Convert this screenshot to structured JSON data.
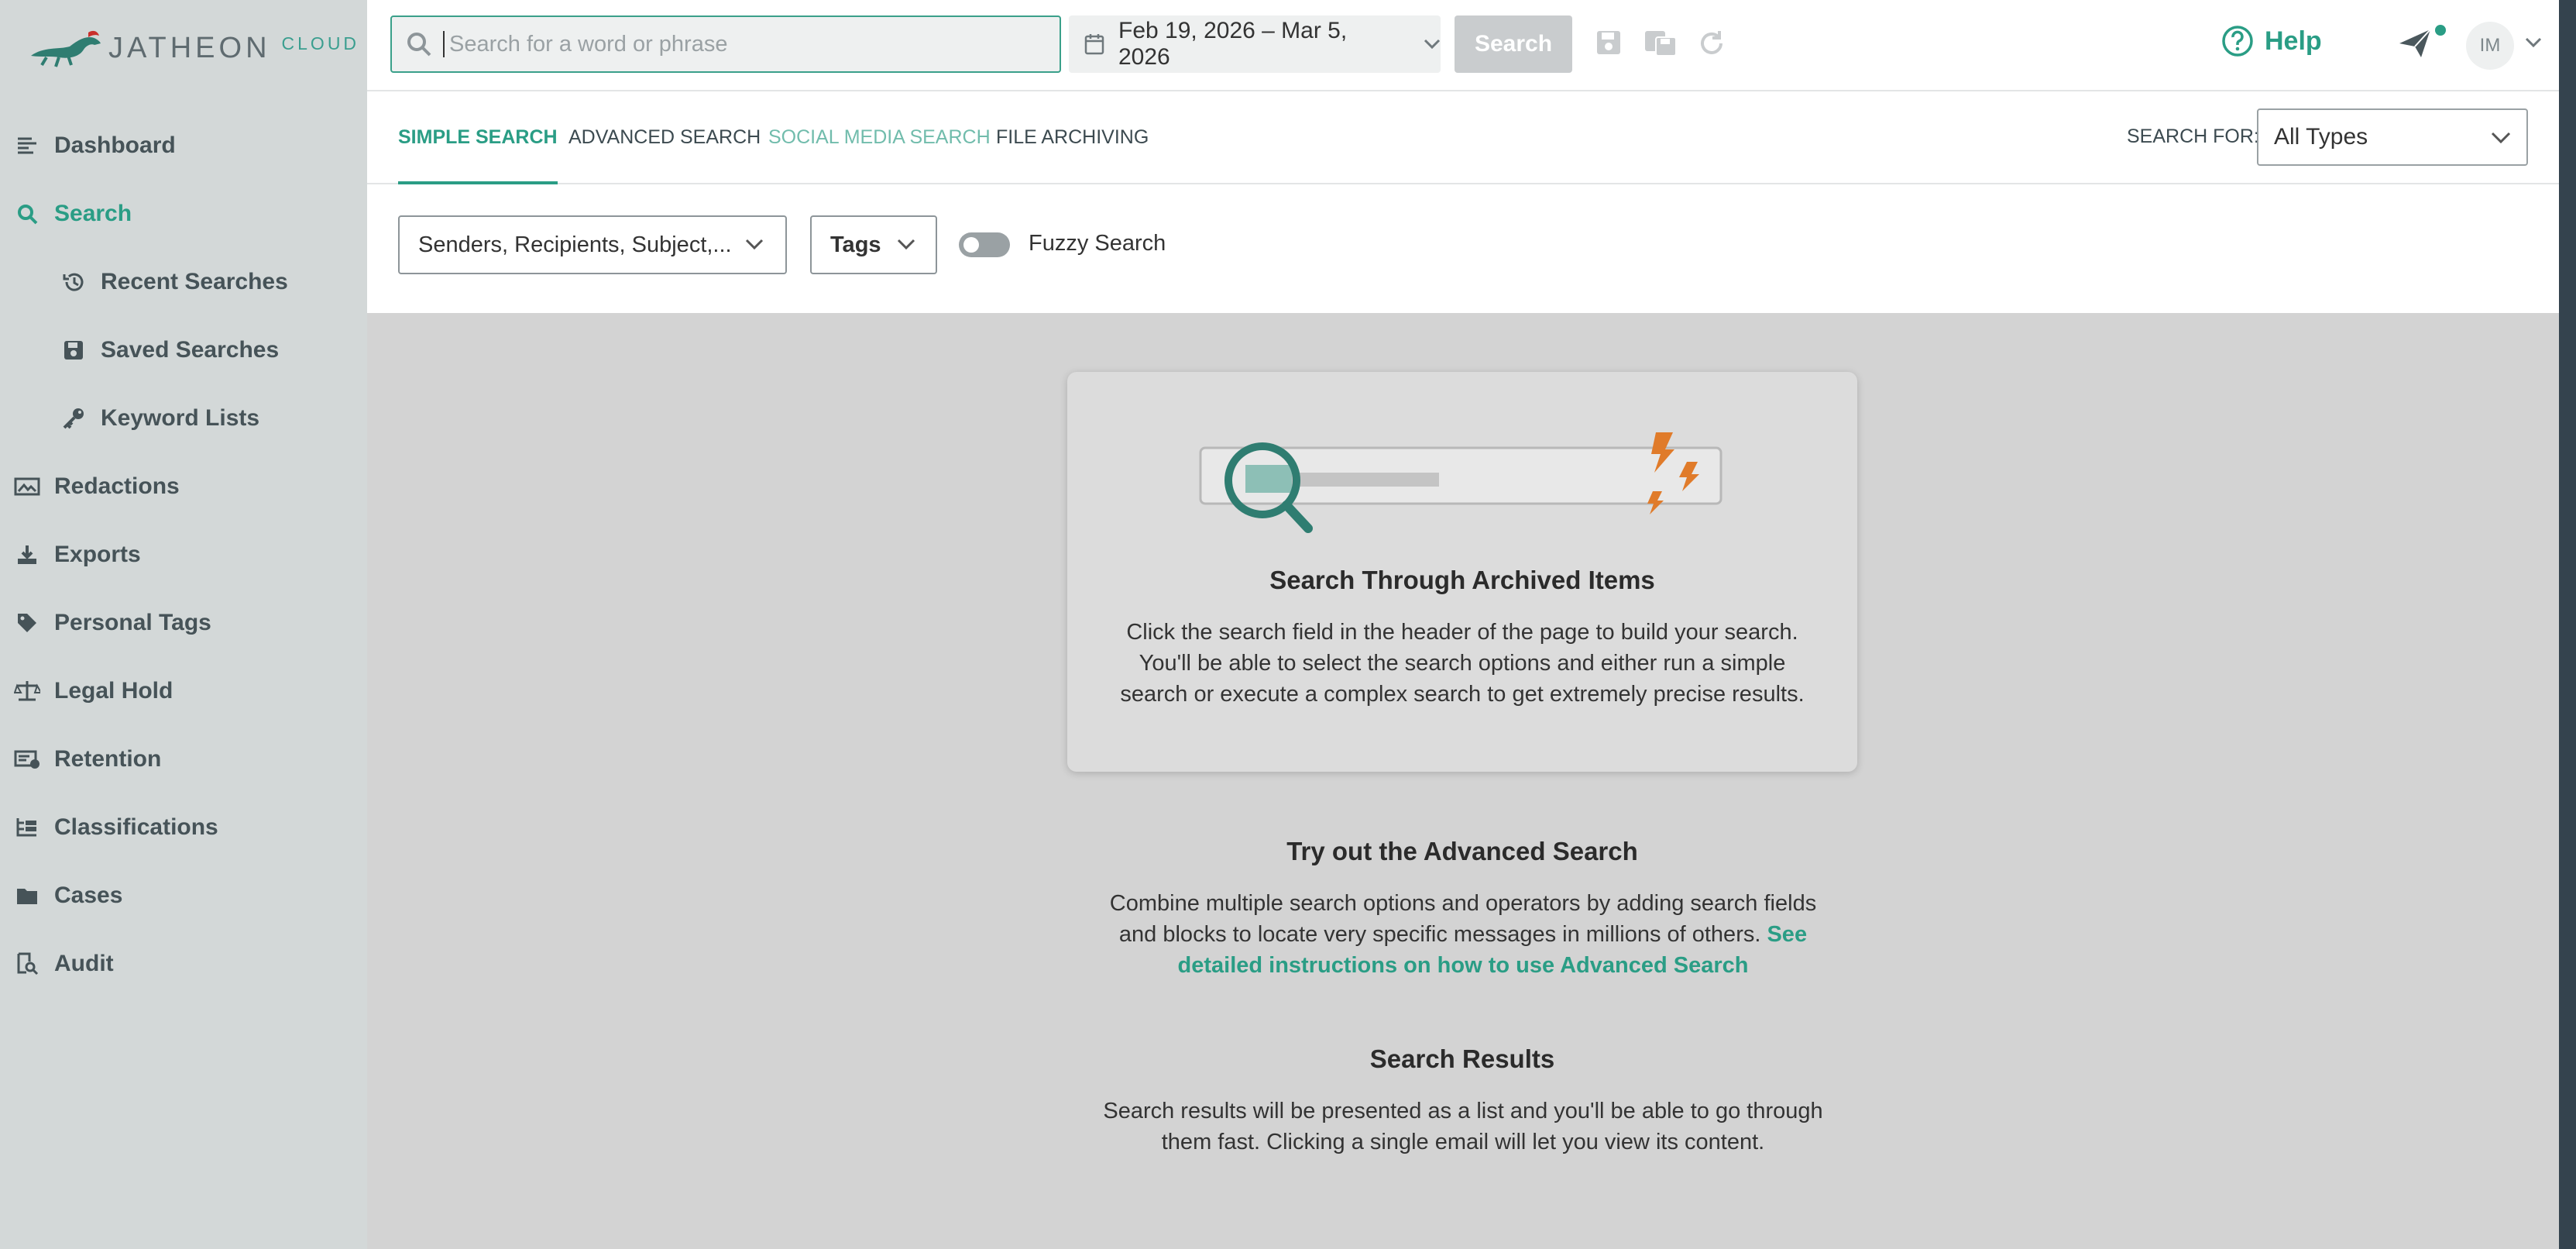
{
  "brand": {
    "name": "JATHEON",
    "suffix": "CLOUD"
  },
  "header": {
    "search_placeholder": "Search for a word or phrase",
    "date_range": "Feb 19, 2026 – Mar 5, 2026",
    "search_button": "Search",
    "help_label": "Help",
    "avatar_initials": "IM"
  },
  "sidebar": {
    "items": [
      {
        "label": "Dashboard",
        "icon": "dashboard-icon"
      },
      {
        "label": "Search",
        "icon": "search-icon",
        "active": true
      },
      {
        "label": "Recent Searches",
        "icon": "history-icon"
      },
      {
        "label": "Saved Searches",
        "icon": "floppy-disk-icon"
      },
      {
        "label": "Keyword Lists",
        "icon": "key-icon"
      },
      {
        "label": "Redactions",
        "icon": "redaction-icon"
      },
      {
        "label": "Exports",
        "icon": "download-icon"
      },
      {
        "label": "Personal Tags",
        "icon": "tag-icon"
      },
      {
        "label": "Legal Hold",
        "icon": "scales-icon"
      },
      {
        "label": "Retention",
        "icon": "retention-icon"
      },
      {
        "label": "Classifications",
        "icon": "classification-icon"
      },
      {
        "label": "Cases",
        "icon": "folder-icon"
      },
      {
        "label": "Audit",
        "icon": "audit-icon"
      }
    ]
  },
  "tabs": {
    "simple": "SIMPLE SEARCH",
    "advanced": "ADVANCED SEARCH",
    "social": "SOCIAL MEDIA SEARCH",
    "files": "FILE ARCHIVING",
    "search_for_label": "SEARCH FOR:",
    "search_for_value": "All Types"
  },
  "filters": {
    "fields_value": "Senders, Recipients, Subject,...",
    "tags_label": "Tags",
    "fuzzy_label": "Fuzzy Search",
    "fuzzy_enabled": false
  },
  "main": {
    "card_title": "Search Through Archived Items",
    "card_text": "Click the search field in the header of the page to build your search. You'll be able to select the search options and either run a simple search or execute a complex search to get extremely precise results.",
    "advanced_title": "Try out the Advanced Search",
    "advanced_text": "Combine multiple search options and operators by adding search fields and blocks to locate very specific messages in millions of others.",
    "advanced_link": "See detailed instructions on how to use Advanced Search",
    "results_title": "Search Results",
    "results_text": "Search results will be presented as a list and you'll be able to go through them fast. Clicking a single email will let you view its content."
  },
  "colors": {
    "accent": "#2a9d85",
    "sidebar_bg": "#d3d8d8",
    "content_bg": "#d3d3d3",
    "lightning": "#e07b2a"
  }
}
